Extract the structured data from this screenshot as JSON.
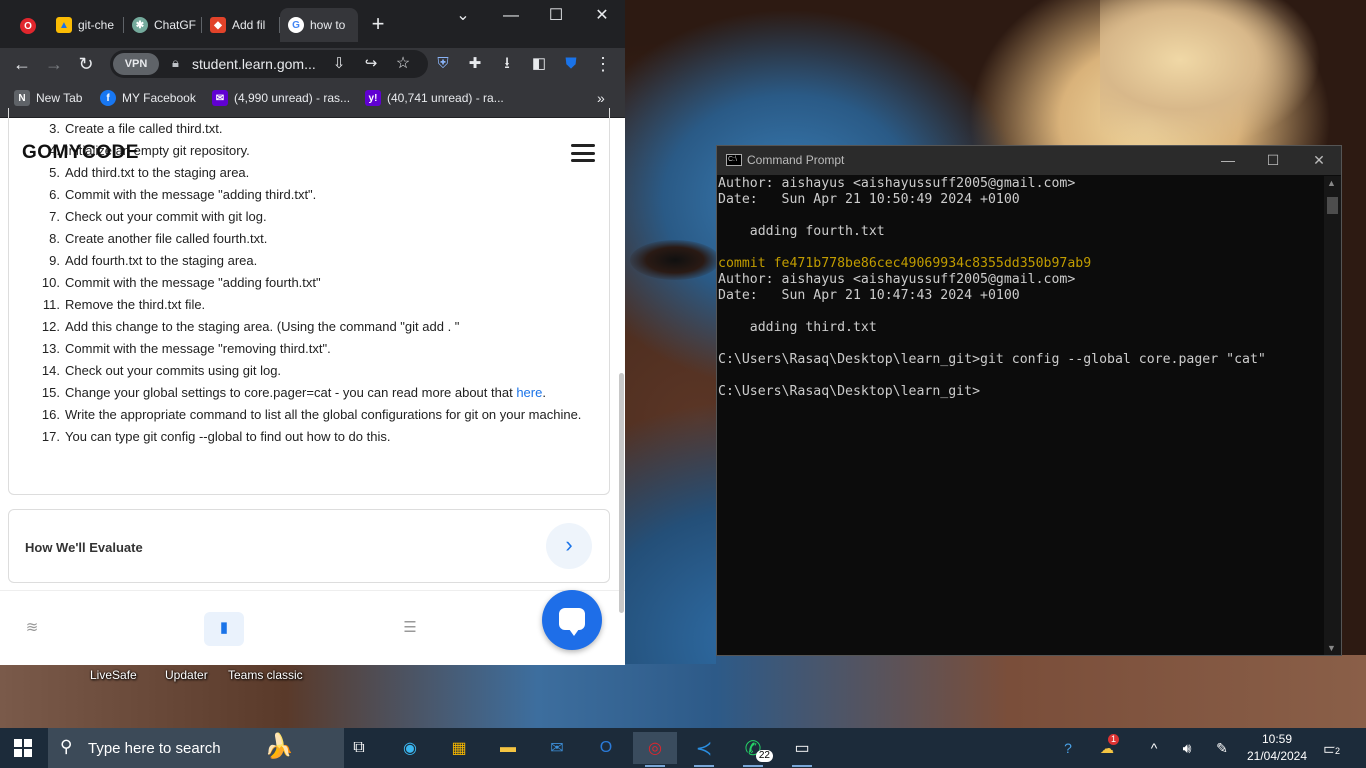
{
  "browser": {
    "tabs": [
      {
        "title": "git-che",
        "icon": "google-drive-icon"
      },
      {
        "title": "ChatGF",
        "icon": "chatgpt-icon"
      },
      {
        "title": "Add fil",
        "icon": "gitlab-icon"
      },
      {
        "title": "how to",
        "icon": "google-icon"
      }
    ],
    "new_tab": "+",
    "vpn_label": "VPN",
    "url": "student.learn.gom...",
    "bookmarks": [
      {
        "label": "New Tab",
        "icon": "newtab-icon"
      },
      {
        "label": "MY Facebook",
        "icon": "facebook-icon"
      },
      {
        "label": "(4,990 unread) - ras...",
        "icon": "yahoo-mail-icon"
      },
      {
        "label": "(40,741 unread) - ra...",
        "icon": "yahoo-icon"
      }
    ],
    "more_bookmarks": "»"
  },
  "page": {
    "logo": "GOMYCODE",
    "steps": [
      {
        "n": "3.",
        "text": "Create a file called third.txt."
      },
      {
        "n": "4.",
        "text": "Initialize an empty git repository."
      },
      {
        "n": "5.",
        "text": "Add third.txt to the staging area."
      },
      {
        "n": "6.",
        "text": "Commit with the message \"adding third.txt\"."
      },
      {
        "n": "7.",
        "text": "Check out your commit with git log."
      },
      {
        "n": "8.",
        "text": "Create another file called fourth.txt."
      },
      {
        "n": "9.",
        "text": "Add fourth.txt to the staging area."
      },
      {
        "n": "10.",
        "text": "Commit with the message \"adding fourth.txt\""
      },
      {
        "n": "11.",
        "text": "Remove the third.txt file."
      },
      {
        "n": "12.",
        "text": "Add this change to the staging area. (Using the command \"git add . \""
      },
      {
        "n": "13.",
        "text": "Commit with the message \"removing third.txt\"."
      },
      {
        "n": "14.",
        "text": "Check out your commits using git log."
      },
      {
        "n": "15.",
        "text": "Change your global settings to core.pager=cat - you can read more about that ",
        "link": "here",
        "after": "."
      },
      {
        "n": "16.",
        "text": "Write the appropriate command to list all the global configurations for git on your machine."
      },
      {
        "n": "17.",
        "text": "You can type git config --global to find out how to do this."
      }
    ],
    "evaluate_title": "How We'll Evaluate"
  },
  "cmd": {
    "title": "Command Prompt",
    "lines": [
      {
        "text": "Author: aishayus <aishayussuff2005@gmail.com>",
        "color": "#cccccc"
      },
      {
        "text": "Date:   Sun Apr 21 10:50:49 2024 +0100",
        "color": "#cccccc"
      },
      {
        "text": "",
        "color": "#cccccc"
      },
      {
        "text": "    adding fourth.txt",
        "color": "#cccccc"
      },
      {
        "text": "",
        "color": "#cccccc"
      },
      {
        "text": "commit fe471b778be86cec49069934c8355dd350b97ab9",
        "color": "#c19c00"
      },
      {
        "text": "Author: aishayus <aishayussuff2005@gmail.com>",
        "color": "#cccccc"
      },
      {
        "text": "Date:   Sun Apr 21 10:47:43 2024 +0100",
        "color": "#cccccc"
      },
      {
        "text": "",
        "color": "#cccccc"
      },
      {
        "text": "    adding third.txt",
        "color": "#cccccc"
      },
      {
        "text": "",
        "color": "#cccccc"
      },
      {
        "text": "C:\\Users\\Rasaq\\Desktop\\learn_git>git config --global core.pager \"cat\"",
        "color": "#cccccc"
      },
      {
        "text": "",
        "color": "#cccccc"
      },
      {
        "text": "C:\\Users\\Rasaq\\Desktop\\learn_git>",
        "color": "#cccccc"
      }
    ]
  },
  "desktop_icons": [
    "LiveSafe",
    "Updater",
    "Teams classic"
  ],
  "taskbar": {
    "search_placeholder": "Type here to search",
    "whatsapp_badge": "22",
    "weather_badge": "1",
    "time": "10:59",
    "date": "21/04/2024",
    "notifications": "2"
  }
}
